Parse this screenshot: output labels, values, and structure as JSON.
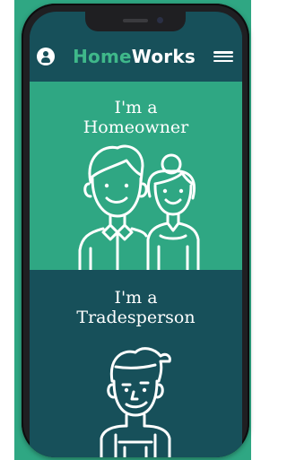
{
  "app": {
    "brand_part1": "Home",
    "brand_part2": "Works"
  },
  "header": {
    "user_icon": "user-icon",
    "menu_icon": "hamburger-menu-icon"
  },
  "homeowner": {
    "line1": "I'm a",
    "line2": "Homeowner",
    "illustration": "couple-illustration"
  },
  "tradesperson": {
    "line1": "I'm a",
    "line2": "Tradesperson",
    "illustration": "tradesperson-illustration"
  },
  "colors": {
    "brand_green": "#2fa783",
    "brand_teal": "#17505a",
    "logo_green": "#3fb88a"
  }
}
